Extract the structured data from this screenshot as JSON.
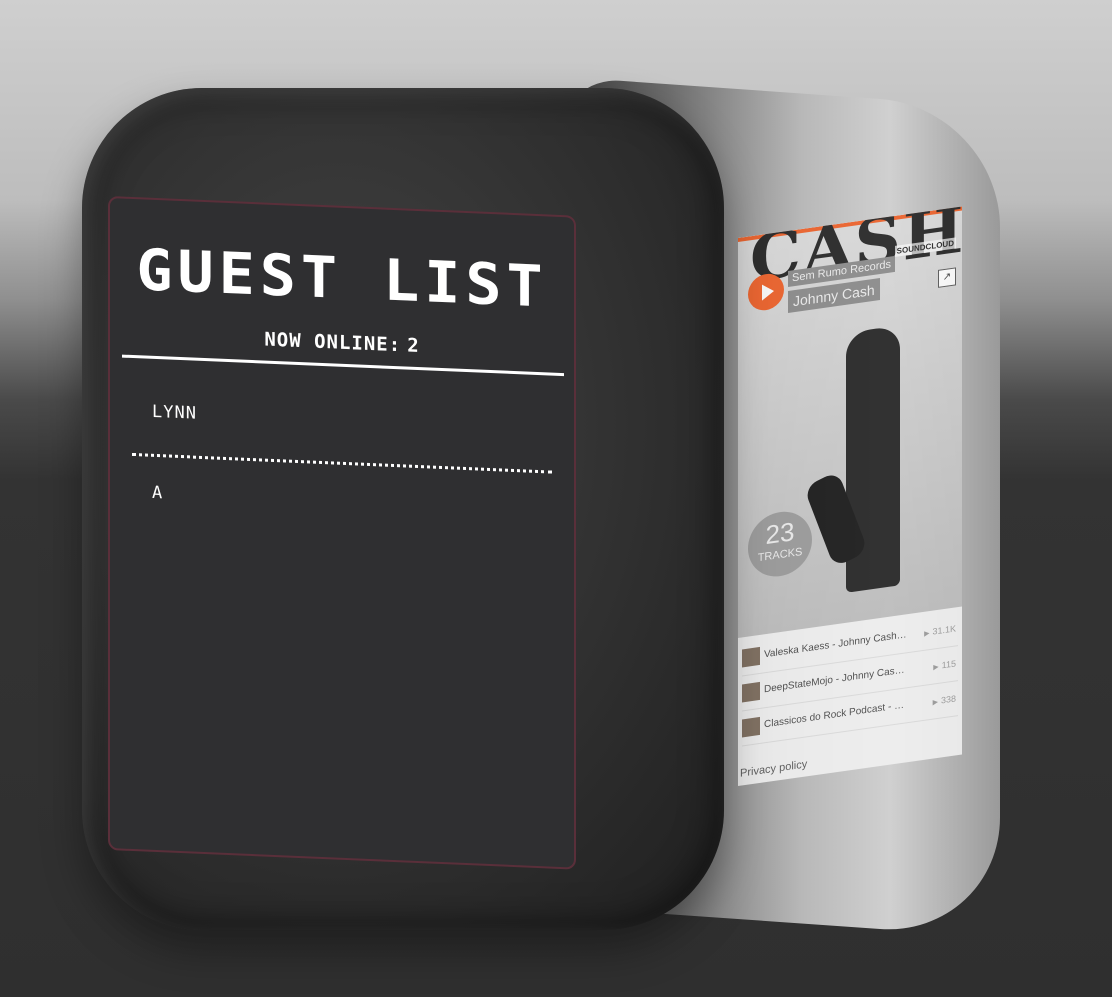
{
  "guest_list": {
    "title": "GUEST LIST",
    "online_label": "NOW ONLINE:",
    "online_count": "2",
    "guests": [
      "LYNN",
      "A"
    ]
  },
  "soundcloud": {
    "album_word": "CASH",
    "brand": "SOUNDCLOUD",
    "uploader": "Sem Rumo Records",
    "track_title": "Johnny Cash",
    "tracks_count": "23",
    "tracks_label": "TRACKS",
    "tracks": [
      {
        "title": "Valeska Kaess - Johnny Cash Best Of Jo...",
        "plays": "31.1K"
      },
      {
        "title": "DeepStateMojo - Johnny Cash At Folsom ...",
        "plays": "115"
      },
      {
        "title": "Classicos do Rock Podcast - Especial JOH...",
        "plays": "338"
      }
    ],
    "privacy": "Privacy policy"
  },
  "colors": {
    "panel_bg": "#2f2f31",
    "panel_border": "#5a2f3a",
    "accent": "#f05d23"
  }
}
